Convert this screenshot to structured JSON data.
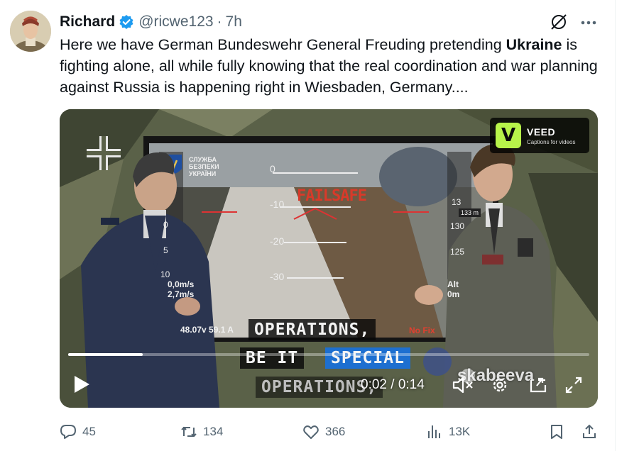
{
  "tweet": {
    "author_name": "Richard",
    "handle": "@ricwe123",
    "separator": "·",
    "time": "7h",
    "text_part1": "Here we have German Bundeswehr General Freuding pretending ",
    "text_bold": "Ukraine",
    "text_part2": " is fighting alone, all while fully knowing that the real coordination and war planning against Russia is happening right in Wiesbaden, Germany...."
  },
  "video": {
    "veed_badge": {
      "logo": "V",
      "title": "VEED",
      "subtitle": "Captions for videos"
    },
    "captions": {
      "line1": "OPERATIONS,",
      "line2_a": "BE IT",
      "line2_b": "SPECIAL",
      "line3": "OPERATIONS,"
    },
    "hud": {
      "org": "СЛУЖБА\nБЕЗПЕКИ\nУКРАЇНИ",
      "failsafe": "FAILSAFE",
      "speed1": "0,0m/s",
      "speed2": "2,7m/s",
      "battery": "48.07v 59.1 A",
      "nofix": "No Fix",
      "alt": "Alt",
      "alt_val": "0m",
      "m133": "133 m",
      "ladder_left": [
        "0",
        "5",
        "10"
      ],
      "ladder_right": [
        "130",
        "125",
        "13"
      ],
      "pitch": [
        "0",
        "-10",
        "-20",
        "-30"
      ]
    },
    "watermark": "skabeeva",
    "time_current": "0:02",
    "time_separator": "/",
    "time_total": "0:14",
    "progress": 0.143
  },
  "actions": {
    "replies": "45",
    "reposts": "134",
    "likes": "366",
    "views": "13K"
  },
  "colors": {
    "verified": "#1d9bf0",
    "muted": "#536471",
    "caption_highlight": "#1d6fd0",
    "veed_green": "#b7f34a"
  },
  "icons": [
    "verified-badge-icon",
    "grok-icon",
    "more-icon",
    "play-icon",
    "volume-muted-icon",
    "settings-icon",
    "pip-icon",
    "fullscreen-icon",
    "reply-icon",
    "repost-icon",
    "like-icon",
    "views-icon",
    "bookmark-icon",
    "share-icon"
  ]
}
